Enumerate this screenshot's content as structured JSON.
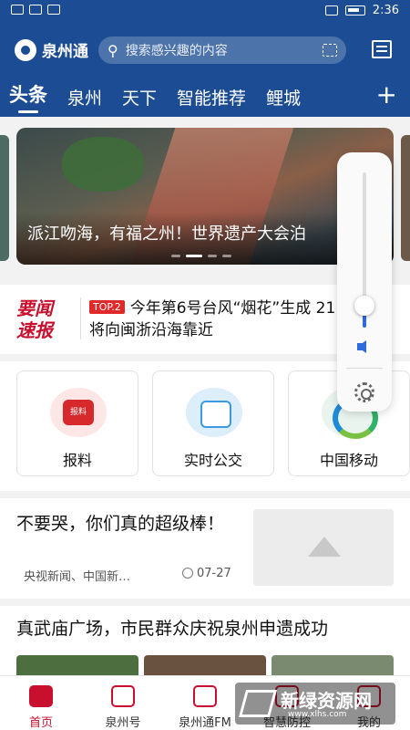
{
  "status": {
    "time": "2:36"
  },
  "app": {
    "name": "泉州通"
  },
  "search": {
    "placeholder": "搜索感兴趣的内容"
  },
  "tabs": [
    {
      "label": "头条"
    },
    {
      "label": "泉州"
    },
    {
      "label": "天下"
    },
    {
      "label": "智能推荐"
    },
    {
      "label": "鲤城"
    }
  ],
  "tab_add": "+",
  "banner": {
    "title": "派江吻海，有福之州！世界遗产大会泊"
  },
  "flash": {
    "logo": "要闻速报",
    "badge": "TOP.2",
    "text": "今年第6号台风“烟花”生成 21日后将向闽浙沿海靠近"
  },
  "shortcuts": [
    {
      "label": "报料",
      "icon": "baoliao-icon"
    },
    {
      "label": "实时公交",
      "icon": "bus-icon"
    },
    {
      "label": "中国移动",
      "icon": "china-mobile-icon"
    }
  ],
  "article1": {
    "headline": "不要哭，你们真的超级棒！",
    "source": "央视新闻、中国新…",
    "date": "07-27"
  },
  "article2": {
    "headline": "真武庙广场，市民群众庆祝泉州申遗成功"
  },
  "bottom_nav": [
    {
      "label": "首页",
      "active": true
    },
    {
      "label": "泉州号",
      "active": false
    },
    {
      "label": "泉州通FM",
      "active": false
    },
    {
      "label": "智慧防控",
      "active": false
    },
    {
      "label": "我的",
      "active": false
    }
  ],
  "volume": {
    "level": 0.14
  },
  "watermark": {
    "title": "新绿资源网",
    "url": "www.xlhs.com"
  },
  "colors": {
    "brand_blue": "#1b4c94",
    "accent_red": "#c8102e",
    "volume_blue": "#2f6bdc"
  }
}
